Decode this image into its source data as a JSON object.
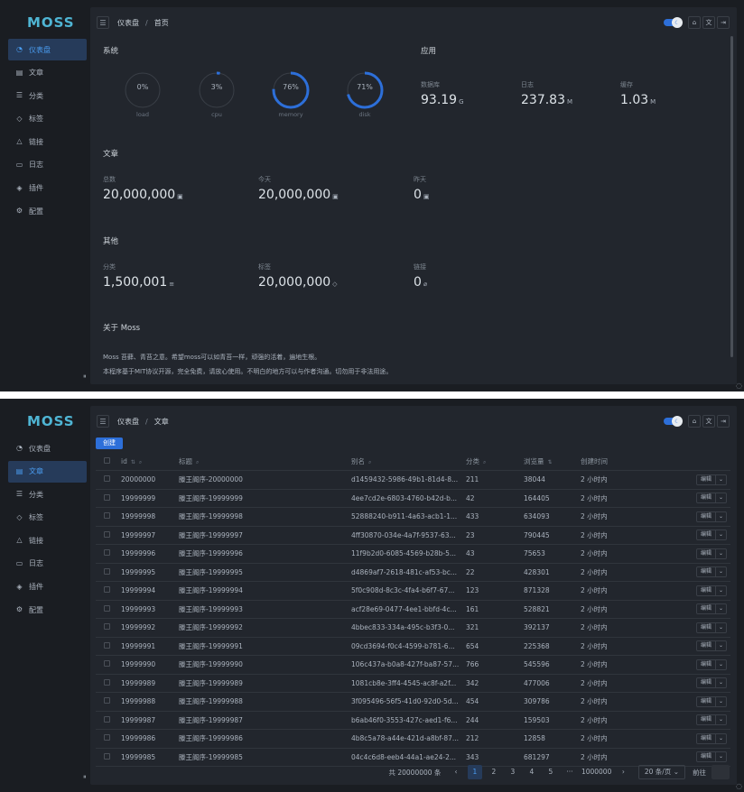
{
  "app": {
    "logo": "MOSS"
  },
  "sidebar": {
    "items": [
      {
        "label": "仪表盘",
        "icon": "dashboard-icon"
      },
      {
        "label": "文章",
        "icon": "document-icon"
      },
      {
        "label": "分类",
        "icon": "table-icon"
      },
      {
        "label": "标签",
        "icon": "tag-icon"
      },
      {
        "label": "链接",
        "icon": "link-icon"
      },
      {
        "label": "日志",
        "icon": "monitor-icon"
      },
      {
        "label": "插件",
        "icon": "layers-icon"
      },
      {
        "label": "配置",
        "icon": "gear-icon"
      }
    ],
    "collapse_label": "⏸"
  },
  "dashboard": {
    "breadcrumb": [
      "仪表盘",
      "首页"
    ],
    "system": {
      "title": "系统",
      "gauges": [
        {
          "label": "load",
          "value": 0
        },
        {
          "label": "cpu",
          "value": 3
        },
        {
          "label": "memory",
          "value": 76
        },
        {
          "label": "disk",
          "value": 71
        }
      ]
    },
    "app_section": {
      "title": "应用",
      "stats": [
        {
          "label": "数据库",
          "value": "93.19",
          "unit": "G"
        },
        {
          "label": "日志",
          "value": "237.83",
          "unit": "M"
        },
        {
          "label": "缓存",
          "value": "1.03",
          "unit": "M"
        }
      ]
    },
    "articles": {
      "title": "文章",
      "stats": [
        {
          "label": "总数",
          "value": "20,000,000"
        },
        {
          "label": "今天",
          "value": "20,000,000"
        },
        {
          "label": "昨天",
          "value": "0"
        }
      ]
    },
    "other": {
      "title": "其他",
      "stats": [
        {
          "label": "分类",
          "value": "1,500,001"
        },
        {
          "label": "标签",
          "value": "20,000,000"
        },
        {
          "label": "链接",
          "value": "0"
        }
      ]
    },
    "about": {
      "title": "关于 Moss",
      "line1": "Moss 苔藓、青苔之意。希望moss可以如青苔一样，顽强的活着，遍地生根。",
      "line2": "本程序基于MIT协议开源，完全免费，请放心使用。不明白的地方可以与作者沟通。切勿用于非法用途。"
    }
  },
  "articles_page": {
    "breadcrumb": [
      "仪表盘",
      "文章"
    ],
    "create_label": "创建",
    "columns": {
      "id": "id",
      "title": "标题",
      "slug": "别名",
      "category": "分类",
      "views": "浏览量",
      "created": "创建时间"
    },
    "edit_label": "编辑",
    "rows": [
      {
        "id": "20000000",
        "title": "滕王阁序-20000000",
        "slug": "d1459432-5986-49b1-81d4-8...",
        "category": "211",
        "views": "38044",
        "created": "2 小时内"
      },
      {
        "id": "19999999",
        "title": "滕王阁序-19999999",
        "slug": "4ee7cd2e-6803-4760-b42d-b...",
        "category": "42",
        "views": "164405",
        "created": "2 小时内"
      },
      {
        "id": "19999998",
        "title": "滕王阁序-19999998",
        "slug": "52888240-b911-4a63-acb1-1...",
        "category": "433",
        "views": "634093",
        "created": "2 小时内"
      },
      {
        "id": "19999997",
        "title": "滕王阁序-19999997",
        "slug": "4ff30870-034e-4a7f-9537-63...",
        "category": "23",
        "views": "790445",
        "created": "2 小时内"
      },
      {
        "id": "19999996",
        "title": "滕王阁序-19999996",
        "slug": "11f9b2d0-6085-4569-b28b-5...",
        "category": "43",
        "views": "75653",
        "created": "2 小时内"
      },
      {
        "id": "19999995",
        "title": "滕王阁序-19999995",
        "slug": "d4869af7-2618-481c-af53-bc...",
        "category": "22",
        "views": "428301",
        "created": "2 小时内"
      },
      {
        "id": "19999994",
        "title": "滕王阁序-19999994",
        "slug": "5f0c908d-8c3c-4fa4-b6f7-67...",
        "category": "123",
        "views": "871328",
        "created": "2 小时内"
      },
      {
        "id": "19999993",
        "title": "滕王阁序-19999993",
        "slug": "acf28e69-0477-4ee1-bbfd-4c...",
        "category": "161",
        "views": "528821",
        "created": "2 小时内"
      },
      {
        "id": "19999992",
        "title": "滕王阁序-19999992",
        "slug": "4bbec833-334a-495c-b3f3-0...",
        "category": "321",
        "views": "392137",
        "created": "2 小时内"
      },
      {
        "id": "19999991",
        "title": "滕王阁序-19999991",
        "slug": "09cd3694-f0c4-4599-b781-6...",
        "category": "654",
        "views": "225368",
        "created": "2 小时内"
      },
      {
        "id": "19999990",
        "title": "滕王阁序-19999990",
        "slug": "106c437a-b0a8-427f-ba87-57...",
        "category": "766",
        "views": "545596",
        "created": "2 小时内"
      },
      {
        "id": "19999989",
        "title": "滕王阁序-19999989",
        "slug": "1081cb8e-3ff4-4545-ac8f-a2f...",
        "category": "342",
        "views": "477006",
        "created": "2 小时内"
      },
      {
        "id": "19999988",
        "title": "滕王阁序-19999988",
        "slug": "3f095496-56f5-41d0-92d0-5d...",
        "category": "454",
        "views": "309786",
        "created": "2 小时内"
      },
      {
        "id": "19999987",
        "title": "滕王阁序-19999987",
        "slug": "b6ab46f0-3553-427c-aed1-f6...",
        "category": "244",
        "views": "159503",
        "created": "2 小时内"
      },
      {
        "id": "19999986",
        "title": "滕王阁序-19999986",
        "slug": "4b8c5a78-a44e-421d-a8bf-87...",
        "category": "212",
        "views": "12858",
        "created": "2 小时内"
      },
      {
        "id": "19999985",
        "title": "滕王阁序-19999985",
        "slug": "04c4c6d8-eeb4-44a1-ae24-2...",
        "category": "343",
        "views": "681297",
        "created": "2 小时内"
      }
    ],
    "pagination": {
      "total": "共 20000000 条",
      "pages": [
        "1",
        "2",
        "3",
        "4",
        "5",
        "···",
        "1000000"
      ],
      "current": "1",
      "page_size": "20 条/页",
      "goto_label": "前往"
    }
  },
  "colors": {
    "accent": "#2d6fd9",
    "logo": "#4fb5d4",
    "background": "#1a1d22",
    "panel": "#22262d"
  }
}
